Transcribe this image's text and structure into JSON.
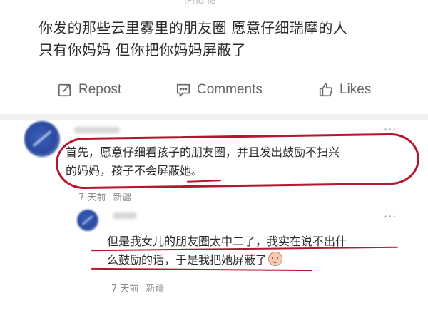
{
  "post": {
    "device": "iPhone",
    "text_line1": "你发的那些云里雾里的朋友圈 愿意仔细瑞摩的人",
    "text_line2": "只有你妈妈 但你把你妈妈屏蔽了"
  },
  "actions": {
    "repost_label": "Repost",
    "comments_label": "Comments",
    "likes_label": "Likes"
  },
  "comments": [
    {
      "text_line1": "首先，愿意仔细看孩子的朋友圈，并且发出鼓励不扫兴",
      "text_line2": "的妈妈，孩子不会屏蔽她。",
      "time": "7 天前",
      "location": "新疆",
      "more": "···"
    }
  ],
  "reply": {
    "text_line1": "但是我女儿的朋友圈太中二了，我实在说不出什",
    "text_line2": "么鼓励的话，于是我把她屏蔽了",
    "time": "7 天前",
    "location": "新疆",
    "more": "···"
  },
  "colors": {
    "annotation": "#b4172f",
    "meta": "#8c8c8c",
    "avatar": "#2a4aa0"
  },
  "icons": {
    "repost": "repost-icon",
    "comments": "comment-icon",
    "likes": "thumbs-up-icon"
  }
}
